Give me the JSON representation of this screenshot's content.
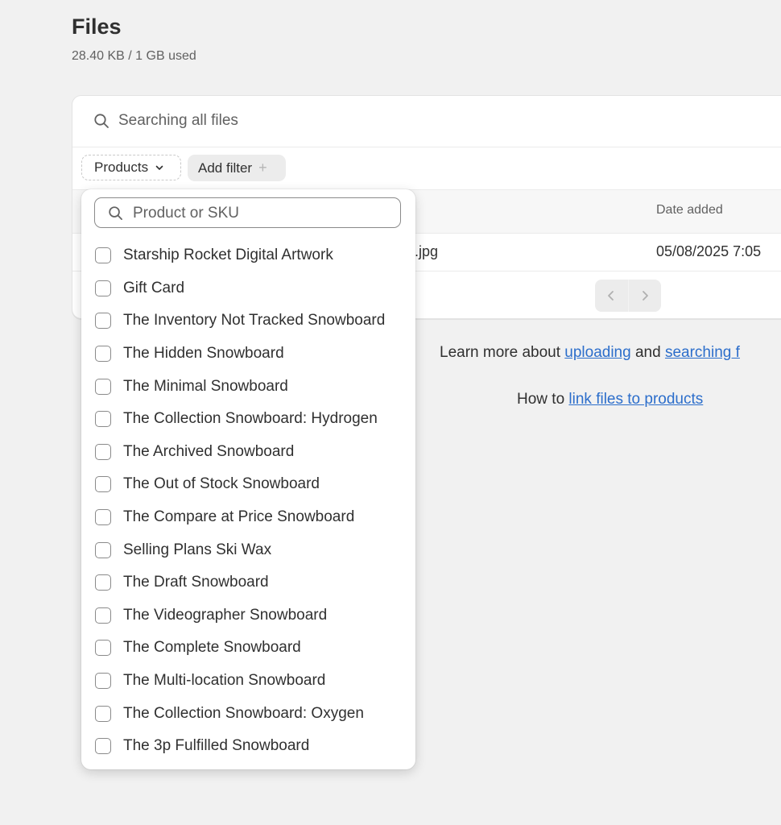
{
  "page": {
    "title": "Files",
    "storage": "28.40 KB / 1 GB used"
  },
  "search": {
    "placeholder": "Searching all files"
  },
  "filters": {
    "products_label": "Products",
    "add_filter_label": "Add filter",
    "add_filter_icon": "+"
  },
  "table": {
    "columns": {
      "date_added": "Date added"
    },
    "rows": [
      {
        "name": ".jpg",
        "date": "05/08/2025 7:05"
      }
    ]
  },
  "help": {
    "learn_prefix": "Learn more about ",
    "uploading_link": "uploading",
    "and": " and ",
    "searching_link": "searching f",
    "howto_prefix": "How to ",
    "link_files_link": "link files to products"
  },
  "product_filter": {
    "placeholder": "Product or SKU",
    "options": [
      "Starship Rocket Digital Artwork",
      "Gift Card",
      "The Inventory Not Tracked Snowboard",
      "The Hidden Snowboard",
      "The Minimal Snowboard",
      "The Collection Snowboard: Hydrogen",
      "The Archived Snowboard",
      "The Out of Stock Snowboard",
      "The Compare at Price Snowboard",
      "Selling Plans Ski Wax",
      "The Draft Snowboard",
      "The Videographer Snowboard",
      "The Complete Snowboard",
      "The Multi-location Snowboard",
      "The Collection Snowboard: Oxygen",
      "The 3p Fulfilled Snowboard"
    ]
  },
  "colors": {
    "background": "#f1f1f1",
    "link": "#2c6ecb",
    "text": "#303030",
    "muted": "#616161"
  }
}
